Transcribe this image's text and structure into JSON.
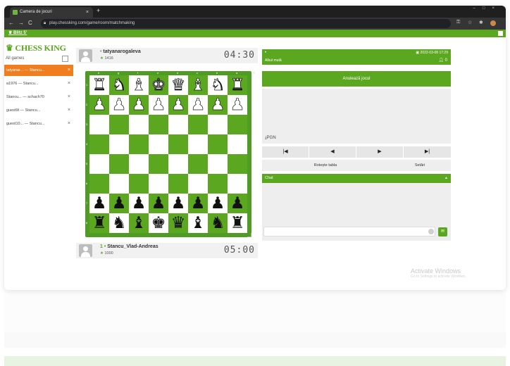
{
  "browser": {
    "tab_title": "Camera de jocuri",
    "tab_close": "×",
    "new_tab": "+",
    "url": "play.chessking.com/game/room/matchmaking"
  },
  "site": {
    "mode_link": "Blitz 5'",
    "logo": "CHESS KING",
    "all_games_label": "All games"
  },
  "games": [
    {
      "label": "tatyanar...  — Stancu...",
      "active": true
    },
    {
      "label": "a1976  — Stancu...",
      "active": false
    },
    {
      "label": "Stancu...  — schach70",
      "active": false
    },
    {
      "label": "guest9t — Stancu...",
      "active": false
    },
    {
      "label": "guest10...  — Stancu...",
      "active": false
    }
  ],
  "top_player": {
    "prefix": "",
    "name": "tatyanarogaleva",
    "rating": "1416",
    "clock": "04:30"
  },
  "bottom_player": {
    "prefix": "1 •",
    "name": "Stancu_Vlad-Andreas",
    "rating": "1000",
    "clock": "05:00"
  },
  "board": {
    "files": [
      "h",
      "g",
      "f",
      "e",
      "d",
      "c",
      "b",
      "a"
    ],
    "ranks": [
      "1",
      "2",
      "3",
      "4",
      "5",
      "6",
      "7",
      "8"
    ],
    "rows": [
      [
        "♜",
        "♞",
        "♝",
        "♚",
        "♛",
        "♝",
        "♞",
        "♜"
      ],
      [
        "♟",
        "♟",
        "♟",
        "♟",
        "♟",
        "♟",
        "♟",
        "♟"
      ],
      [
        "",
        "",
        "",
        "",
        "",
        "",
        "",
        ""
      ],
      [
        "",
        "",
        "",
        "",
        "",
        "",
        "",
        ""
      ],
      [
        "",
        "",
        "",
        "",
        "",
        "",
        "",
        ""
      ],
      [
        "",
        "",
        "",
        "",
        "",
        "",
        "",
        ""
      ],
      [
        "♟",
        "♟",
        "♟",
        "♟",
        "♟",
        "♟",
        "♟",
        "♟"
      ],
      [
        "♜",
        "♞",
        "♝",
        "♚",
        "♛",
        "♝",
        "♞",
        "♜"
      ]
    ],
    "colors": [
      "w",
      "w",
      "",
      "",
      "",
      "",
      "b",
      "b"
    ]
  },
  "panel": {
    "date": "2022-03-08 17:29",
    "move_label": "Albul mută",
    "count": "0",
    "abort": "Anulează jocul",
    "pgn": "PGN",
    "controls": [
      "|◀",
      "◀",
      "▶",
      "▶|"
    ],
    "rotate": "Rotește tabla",
    "settings": "Setări",
    "chat_title": "Chat"
  },
  "watermark": {
    "title": "Activate Windows",
    "sub": "Go to Settings to activate Windows."
  },
  "colors": {
    "brand_green": "#5ba71f",
    "active_orange": "#f07d1e",
    "board_dark": "#5ba71f",
    "board_light": "#ffffff"
  }
}
